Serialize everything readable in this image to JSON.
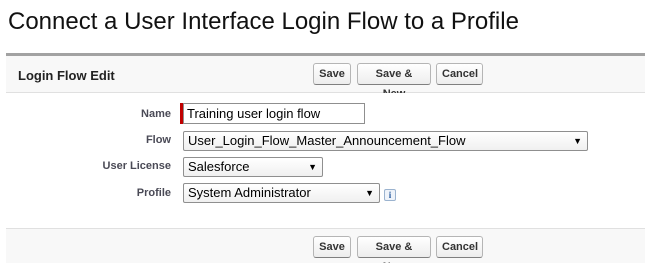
{
  "page": {
    "heading": "Connect a User Interface Login Flow to a Profile"
  },
  "panel": {
    "title": "Login Flow Edit"
  },
  "buttons": {
    "save": "Save",
    "save_new": "Save & New",
    "cancel": "Cancel"
  },
  "form": {
    "name": {
      "label": "Name",
      "value": "Training user login flow",
      "required": true
    },
    "flow": {
      "label": "Flow",
      "selected": "User_Login_Flow_Master_Announcement_Flow"
    },
    "user_license": {
      "label": "User License",
      "selected": "Salesforce"
    },
    "profile": {
      "label": "Profile",
      "selected": "System Administrator",
      "info_icon": "info-icon"
    }
  },
  "icons": {
    "dropdown": "▼",
    "info": "i"
  },
  "colors": {
    "required_marker": "#c00000",
    "panel_border": "#a2a2a2",
    "label_text": "#4a4a56"
  }
}
